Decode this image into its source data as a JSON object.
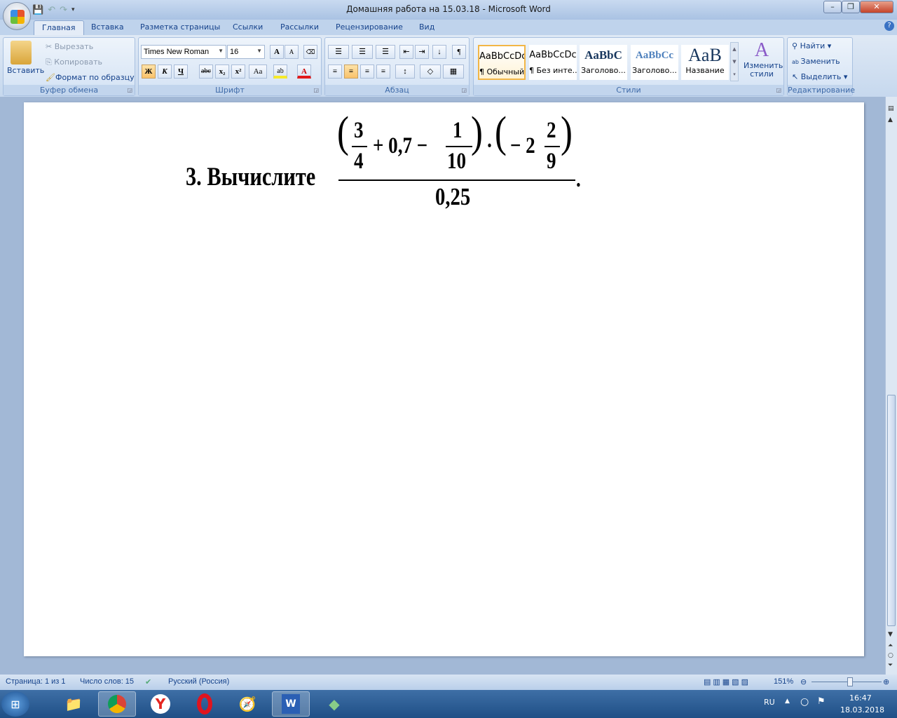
{
  "window": {
    "title": "Домашняя работа на 15.03.18 - Microsoft Word",
    "minimize": "–",
    "restore": "❐",
    "close": "✕"
  },
  "tabs": [
    "Главная",
    "Вставка",
    "Разметка страницы",
    "Ссылки",
    "Рассылки",
    "Рецензирование",
    "Вид"
  ],
  "clipboard": {
    "paste": "Вставить",
    "cut": "Вырезать",
    "copy": "Копировать",
    "format_painter": "Формат по образцу",
    "label": "Буфер обмена"
  },
  "font": {
    "name": "Times New Roman",
    "size": "16",
    "label": "Шрифт",
    "grow": "A",
    "shrink": "A",
    "bold": "Ж",
    "italic": "К",
    "underline": "Ч",
    "strike": "abc",
    "sub": "x₂",
    "sup": "x²",
    "case": "Aa",
    "highlight": "ab",
    "color": "A"
  },
  "paragraph": {
    "label": "Абзац",
    "pilcrow": "¶"
  },
  "styles": {
    "label": "Стили",
    "items": [
      {
        "preview": "AaBbCcDc",
        "name": "¶ Обычный"
      },
      {
        "preview": "AaBbCcDc",
        "name": "¶ Без инте..."
      },
      {
        "preview": "AaBbC",
        "name": "Заголово..."
      },
      {
        "preview": "AaBbCc",
        "name": "Заголово..."
      },
      {
        "preview": "AaB",
        "name": "Название"
      }
    ],
    "change": "Изменить стили"
  },
  "editing": {
    "label": "Редактирование",
    "find": "Найти",
    "replace": "Заменить",
    "select": "Выделить"
  },
  "document": {
    "prefix": "3. Вычислите",
    "n1": "3",
    "d1": "4",
    "mid": "+ 0,7 −",
    "n2": "1",
    "d2": "10",
    "dot": "·",
    "minus2": "− 2",
    "n3": "2",
    "d3": "9",
    "denominator": "0,25",
    "end": "."
  },
  "status": {
    "page": "Страница: 1 из 1",
    "words": "Число слов: 15",
    "language": "Русский (Россия)",
    "zoom": "151%"
  },
  "taskbar": {
    "lang": "RU",
    "time": "16:47",
    "date": "18.03.2018"
  }
}
